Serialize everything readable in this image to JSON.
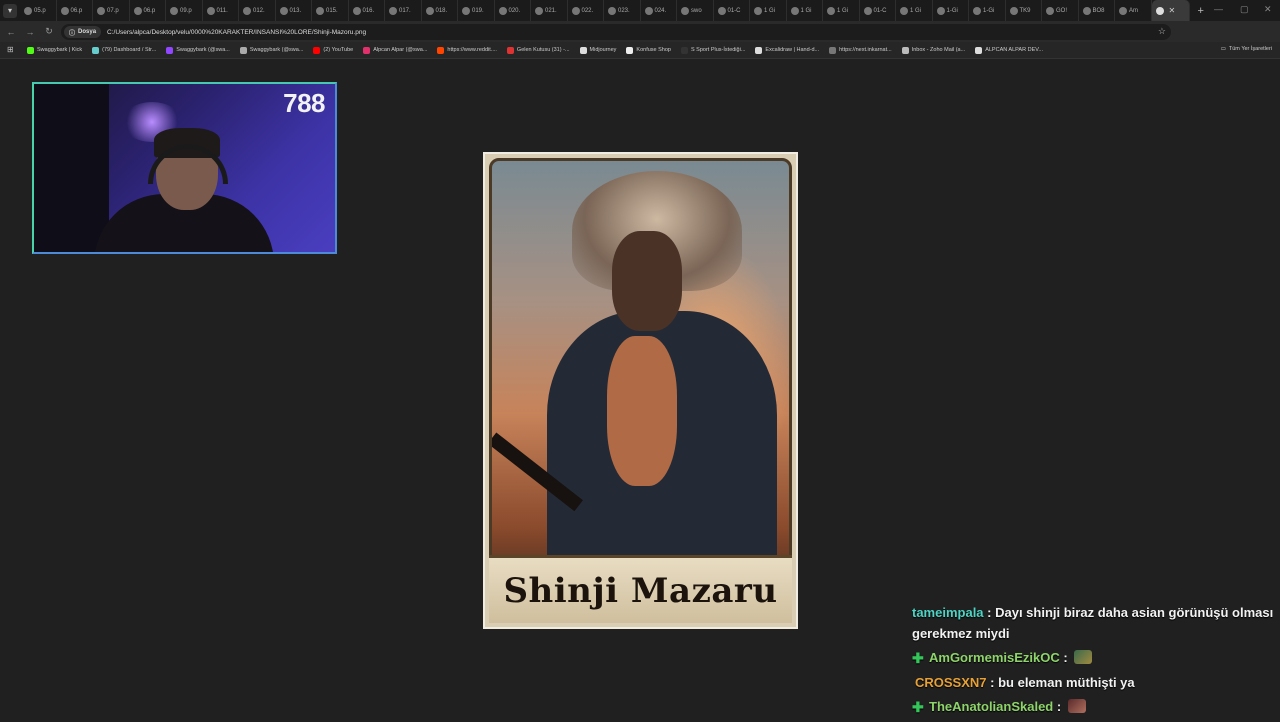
{
  "browser": {
    "tabs": [
      "05.p",
      "06.p",
      "07.p",
      "06.p",
      "09.p",
      "011.",
      "012.",
      "013.",
      "015.",
      "016.",
      "017.",
      "018.",
      "019.",
      "020.",
      "021.",
      "022.",
      "023.",
      "024.",
      "swo",
      "01-C",
      "1 Gi",
      "1 Gi",
      "1 Gi",
      "01-C",
      "1 Gi",
      "1-Gi",
      "1-Gi",
      "TK9",
      "GO!",
      "BO8",
      "Am"
    ],
    "active_tab": "",
    "address_chip": "Dosya",
    "url": "C:/Users/alpca/Desktop/velu/0000%20KARAKTER/INSANSI%20LORE/Shinji-Mazoru.png"
  },
  "bookmarks": {
    "items": [
      {
        "label": "Swaggybark | Kick",
        "color": "#53fc18"
      },
      {
        "label": "(79) Dashboard / Str...",
        "color": "#6cc"
      },
      {
        "label": "Swaggybark (@swa...",
        "color": "#9146ff"
      },
      {
        "label": "Swaggybark (@swa...",
        "color": "#aaa"
      },
      {
        "label": "(2) YouTube",
        "color": "#f00"
      },
      {
        "label": "Alpcan Alpar (@swa...",
        "color": "#e1306c"
      },
      {
        "label": "https://www.reddit....",
        "color": "#ff4500"
      },
      {
        "label": "Gelen Kutusu (31) -...",
        "color": "#d33"
      },
      {
        "label": "Midjourney",
        "color": "#ddd"
      },
      {
        "label": "Konfuse Shop",
        "color": "#eee"
      },
      {
        "label": "S Sport Plus-İstediği...",
        "color": "#333"
      },
      {
        "label": "Excalidraw | Hand-d...",
        "color": "#ddd"
      },
      {
        "label": "https://next.inkarnat...",
        "color": "#777"
      },
      {
        "label": "Inbox - Zoho Mail (a...",
        "color": "#bbb"
      },
      {
        "label": "ALPCAN ALPAR DEV...",
        "color": "#ddd"
      }
    ],
    "all_label": "Tüm Yer İşaretleri"
  },
  "webcam": {
    "counter": "788"
  },
  "card": {
    "name": "Shinji Mazaru"
  },
  "chat": {
    "messages": [
      {
        "user": "tameimpala",
        "text": "Dayı shinji biraz daha asian görünüşü olması gerekmez miydi"
      },
      {
        "user": "AmGormemisEzikOC",
        "text": ""
      },
      {
        "user": "CROSSXN7",
        "text": "bu eleman müthişti ya"
      },
      {
        "user": "TheAnatolianSkaled",
        "text": ""
      }
    ]
  }
}
